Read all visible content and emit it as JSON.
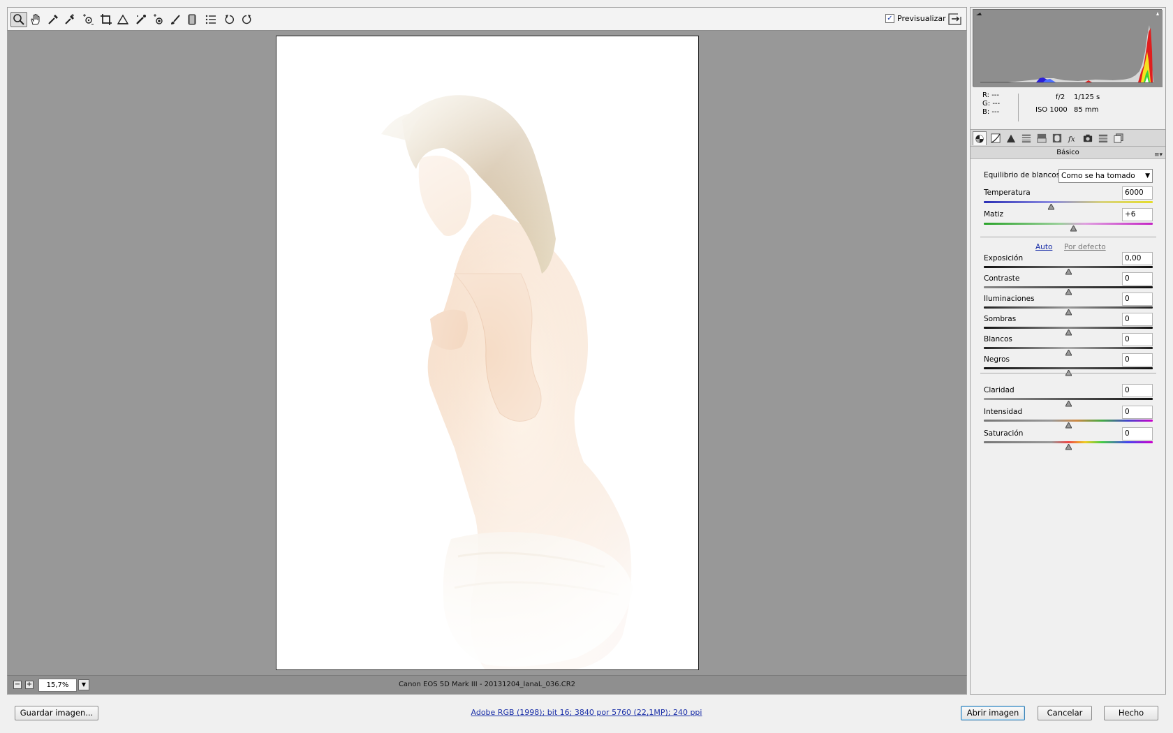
{
  "toolbar": {
    "tools": [
      "zoom-icon",
      "hand-icon",
      "white-balance-icon",
      "color-sampler-icon",
      "targeted-adjustment-icon",
      "crop-icon",
      "straighten-icon",
      "spot-removal-icon",
      "red-eye-icon",
      "adjustment-brush-icon",
      "graduated-filter-icon",
      "list-icon",
      "rotate-left-icon",
      "rotate-right-icon"
    ],
    "preview_label": "Previsualizar",
    "preview_checked": true
  },
  "statusbar": {
    "zoom_minus": "−",
    "zoom_plus": "+",
    "zoom_value": "15,7%",
    "file_info": "Canon EOS 5D Mark III - 20131204_lanaL_036.CR2"
  },
  "panel": {
    "exif": {
      "r_label": "R:",
      "r_value": "---",
      "g_label": "G:",
      "g_value": "---",
      "b_label": "B:",
      "b_value": "---",
      "aperture": "f/2",
      "shutter": "1/125 s",
      "iso": "ISO 1000",
      "focal": "85 mm"
    },
    "tabs": [
      "basic-icon",
      "tone-curve-icon",
      "detail-icon",
      "hsl-icon",
      "split-toning-icon",
      "lens-corrections-icon",
      "effects-icon",
      "camera-calibration-icon",
      "presets-icon",
      "snapshots-icon"
    ],
    "section_title": "Básico",
    "white_balance_label": "Equilibrio de blancos:",
    "white_balance_value": "Como se ha tomado",
    "temperature": {
      "label": "Temperatura",
      "value": "6000",
      "position": 0.4
    },
    "tint": {
      "label": "Matiz",
      "value": "+6",
      "position": 0.53
    },
    "auto_link": "Auto",
    "default_link": "Por defecto",
    "tone": [
      {
        "label": "Exposición",
        "value": "0,00",
        "position": 0.5
      },
      {
        "label": "Contraste",
        "value": "0",
        "position": 0.5
      },
      {
        "label": "Iluminaciones",
        "value": "0",
        "position": 0.5
      },
      {
        "label": "Sombras",
        "value": "0",
        "position": 0.5
      },
      {
        "label": "Blancos",
        "value": "0",
        "position": 0.5
      },
      {
        "label": "Negros",
        "value": "0",
        "position": 0.5
      }
    ],
    "presence": [
      {
        "label": "Claridad",
        "value": "0",
        "position": 0.5
      },
      {
        "label": "Intensidad",
        "value": "0",
        "position": 0.5
      },
      {
        "label": "Saturación",
        "value": "0",
        "position": 0.5
      }
    ]
  },
  "bottom": {
    "save_label": "Guardar imagen...",
    "workflow_text": "Adobe RGB (1998); bit 16; 3840 por 5760 (22,1MP); 240 ppi",
    "open_label": "Abrir imagen",
    "cancel_label": "Cancelar",
    "done_label": "Hecho"
  }
}
